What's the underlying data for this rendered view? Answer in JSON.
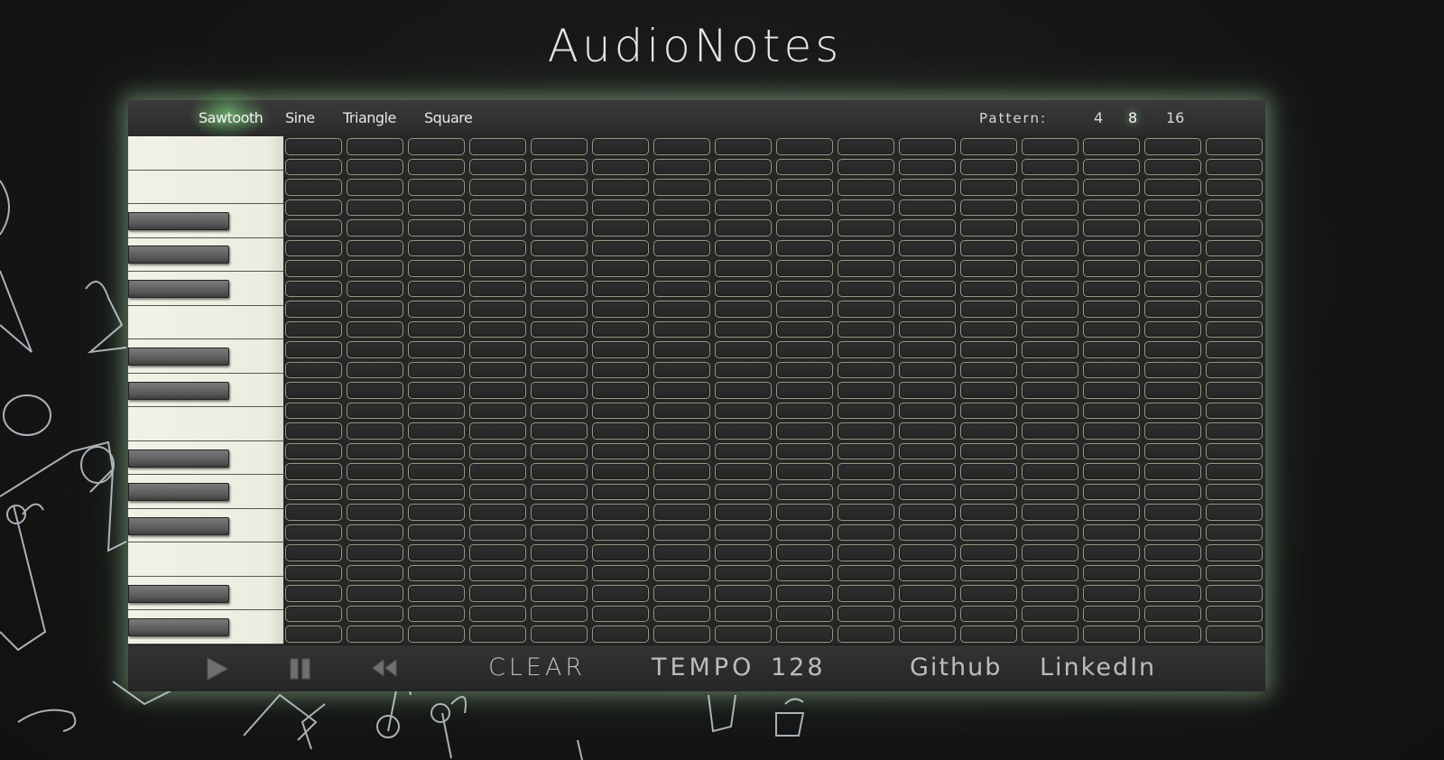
{
  "app": {
    "title": "AudioNotes"
  },
  "waveforms": {
    "options": [
      "Sawtooth",
      "Sine",
      "Triangle",
      "Square"
    ],
    "selected": "Sawtooth"
  },
  "pattern": {
    "label": "Pattern:",
    "options": [
      "4",
      "8",
      "16"
    ],
    "selected": "8"
  },
  "piano": {
    "key_pattern": [
      "w",
      "w",
      "b",
      "b",
      "b",
      "w",
      "b",
      "b",
      "w",
      "b",
      "b",
      "b",
      "w",
      "b",
      "b"
    ]
  },
  "sequencer": {
    "rows": 25,
    "steps": 16,
    "active_cells": []
  },
  "transport": {
    "play_icon": "play-icon",
    "pause_icon": "pause-icon",
    "rewind_icon": "rewind-icon",
    "clear_label": "CLEAR",
    "tempo_label": "TEMPO",
    "tempo_value": "128"
  },
  "links": {
    "github": "Github",
    "linkedin": "LinkedIn"
  },
  "colors": {
    "glow": "#8fe68f",
    "cell_border": "#8f9d80",
    "key_white": "#f0f0e4",
    "key_black": "#5e5e5e"
  }
}
